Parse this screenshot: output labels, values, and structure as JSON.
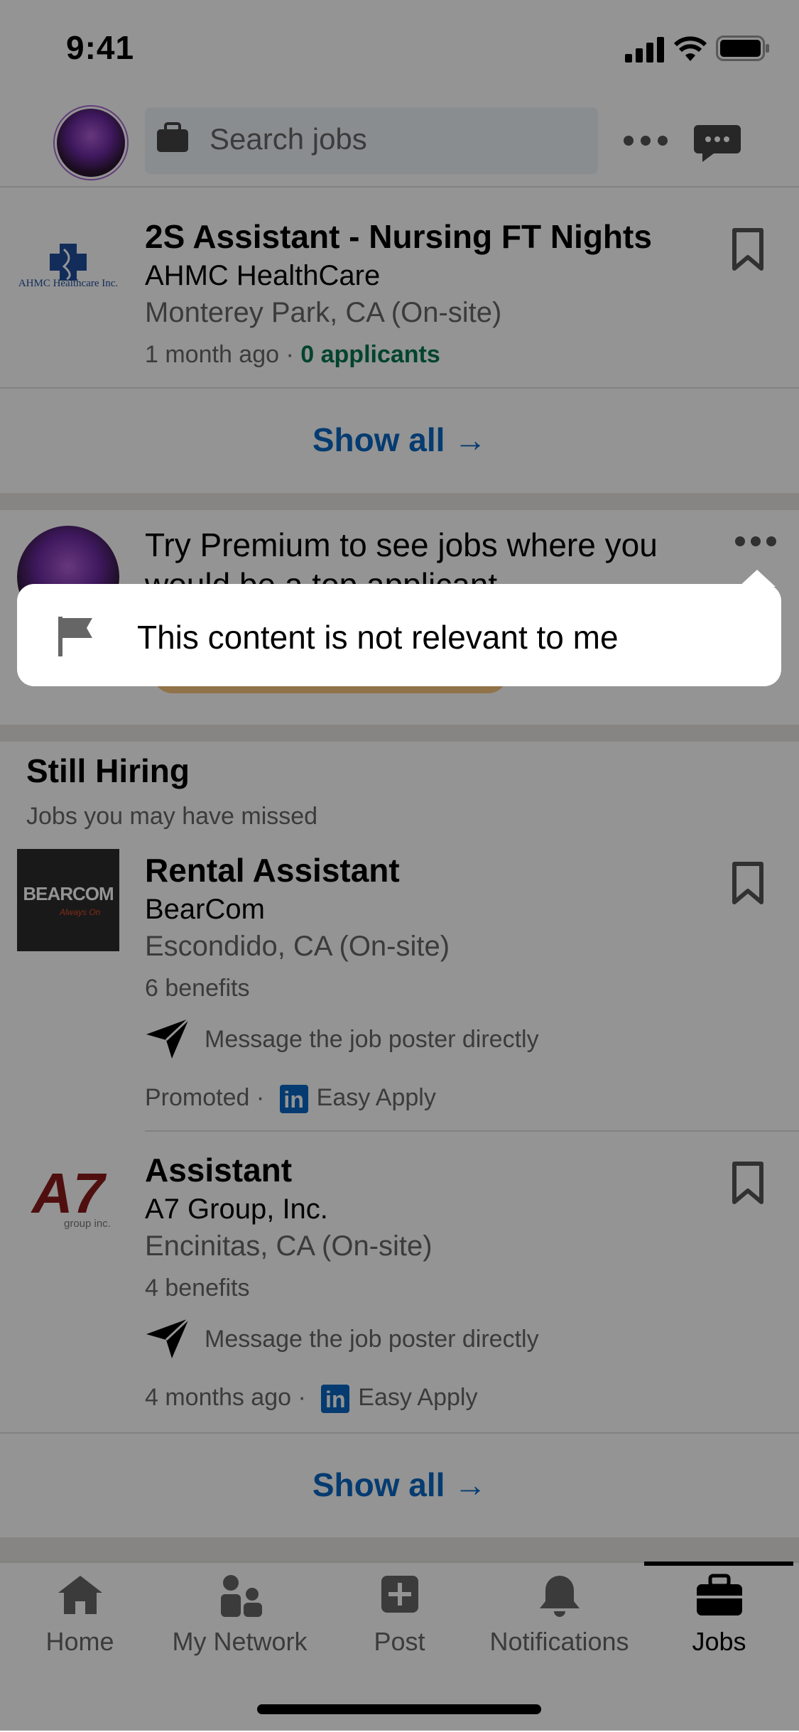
{
  "status_bar": {
    "time": "9:41"
  },
  "header": {
    "search_placeholder": "Search jobs"
  },
  "job_card_1": {
    "logo_text": "AHMC Healthcare Inc.",
    "title": "2S Assistant - Nursing FT Nights",
    "company": "AHMC HealthCare",
    "location": "Monterey Park, CA (On-site)",
    "posted": "1 month ago",
    "separator": "·",
    "applicants": "0 applicants"
  },
  "show_all_label": "Show all →",
  "premium": {
    "text": "Try Premium to see jobs where you",
    "text_line2": "would be a top applicant"
  },
  "still_hiring": {
    "title": "Still Hiring",
    "subtitle": "Jobs you may have missed",
    "jobs": [
      {
        "logo_text": "BEARCOM",
        "logo_sub": "Always On",
        "title": "Rental Assistant",
        "company": "BearCom",
        "location": "Escondido, CA (On-site)",
        "benefits": "6 benefits",
        "message": "Message the job poster directly",
        "footer_left": "Promoted",
        "easy_apply": "Easy Apply"
      },
      {
        "logo_text": "A7",
        "logo_sub": "group inc.",
        "title": "Assistant",
        "company": "A7 Group, Inc.",
        "location": "Encinitas, CA (On-site)",
        "benefits": "4 benefits",
        "message": "Message the job poster directly",
        "footer_left": "4 months ago",
        "easy_apply": "Easy Apply"
      }
    ]
  },
  "tabbar": {
    "tabs": [
      {
        "label": "Home",
        "icon": "home-icon"
      },
      {
        "label": "My Network",
        "icon": "network-icon"
      },
      {
        "label": "Post",
        "icon": "post-icon"
      },
      {
        "label": "Notifications",
        "icon": "bell-icon"
      },
      {
        "label": "Jobs",
        "icon": "briefcase-icon",
        "active": true
      }
    ]
  },
  "popup": {
    "item_label": "This content is not relevant to me",
    "icon": "flag-icon"
  },
  "colors": {
    "brand_blue": "#0a66c2",
    "green": "#01754f",
    "overlay": "rgba(0,0,0,0.42)"
  }
}
